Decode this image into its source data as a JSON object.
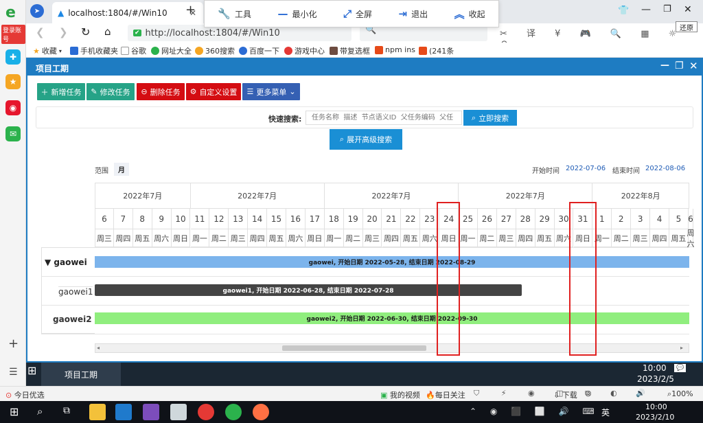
{
  "sidebar": {
    "badge": "登录账号"
  },
  "browser": {
    "tab_label": "localhost:1804/#/Win10",
    "url": "http://localhost:1804/#/Win10",
    "restore_tip": "还原",
    "bookmarks": [
      "收藏",
      "手机收藏夹",
      "谷歌",
      "网址大全",
      "360搜索",
      "百度一下",
      "游戏中心",
      "带复选框",
      "npm ins",
      "(241条"
    ]
  },
  "toolpop": {
    "tools": "工具",
    "minimize": "最小化",
    "fullscreen": "全屏",
    "exit": "退出",
    "collapse": "收起"
  },
  "app": {
    "title": "项目工期",
    "buttons": {
      "add": "新增任务",
      "edit": "修改任务",
      "delete": "删除任务",
      "custom": "自定义设置",
      "more": "更多菜单"
    },
    "quick_search_label": "快速搜索:",
    "search_placeholder": "任务名称  描述  节点语义ID  父任务编码  父任",
    "search_button": "立即搜索",
    "advanced_button": "展开高级搜索",
    "range_label": "范围",
    "range_value": "月",
    "start_label": "开始时间",
    "start_value": "2022-07-06",
    "end_label": "结束时间",
    "end_value": "2022-08-06"
  },
  "gantt": {
    "months": [
      "2022年7月",
      "2022年7月",
      "2022年7月",
      "2022年7月",
      "2022年8月"
    ],
    "days": [
      "6",
      "7",
      "8",
      "9",
      "10",
      "11",
      "12",
      "13",
      "14",
      "15",
      "16",
      "17",
      "18",
      "19",
      "20",
      "21",
      "22",
      "23",
      "24",
      "25",
      "26",
      "27",
      "28",
      "29",
      "30",
      "31",
      "1",
      "2",
      "3",
      "4",
      "5",
      "6"
    ],
    "weekdays": [
      "周三",
      "周四",
      "周五",
      "周六",
      "周日",
      "周一",
      "周二",
      "周三",
      "周四",
      "周五",
      "周六",
      "周日",
      "周一",
      "周二",
      "周三",
      "周四",
      "周五",
      "周六",
      "周日",
      "周一",
      "周二",
      "周三",
      "周四",
      "周五",
      "周六",
      "周日",
      "周一",
      "周二",
      "周三",
      "周四",
      "周五",
      "周六"
    ],
    "rows": [
      {
        "name": "▼ gaowei",
        "bar": "gaowei, 开始日期 2022-05-28, 结束日期 2022-08-29",
        "color": "#7cb4ec"
      },
      {
        "name": "gaowei1",
        "bar": "gaowei1, 开始日期 2022-06-28, 结束日期 2022-07-28",
        "color": "#444444"
      },
      {
        "name": "gaowei2",
        "bar": "gaowei2, 开始日期 2022-06-30, 结束日期 2022-09-30",
        "color": "#90ee7e"
      }
    ]
  },
  "taskbar": {
    "app_item": "项目工期",
    "time": "10:00",
    "date": "2023/2/5"
  },
  "statusbar": {
    "today": "今日优选",
    "video": "我的视频",
    "daily": "每日关注",
    "download": "下载",
    "zoom": "100%"
  },
  "os": {
    "time": "10:00",
    "date": "2023/2/10",
    "ime": "英"
  }
}
